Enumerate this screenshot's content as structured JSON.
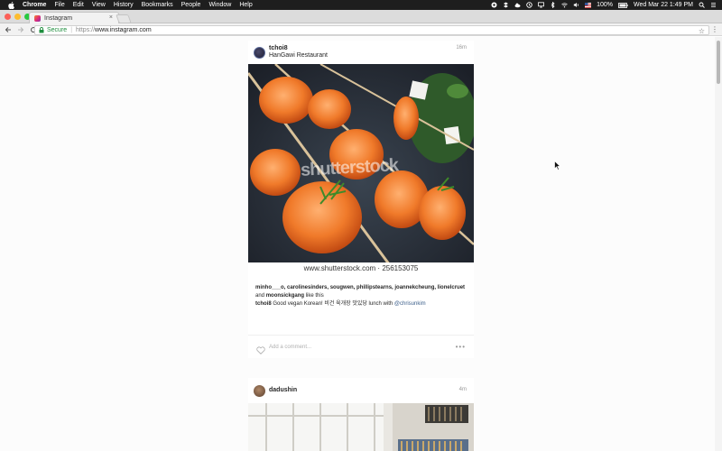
{
  "menubar": {
    "app": "Chrome",
    "items": [
      "File",
      "Edit",
      "View",
      "History",
      "Bookmarks",
      "People",
      "Window",
      "Help"
    ],
    "battery": "100%",
    "clock": "Wed Mar 22  1:49 PM"
  },
  "tab": {
    "title": "Instagram",
    "close": "×"
  },
  "toolbar": {
    "secure_label": "Secure",
    "url_scheme": "https://",
    "url_host": "www.instagram.com"
  },
  "posts": [
    {
      "username": "tchoi8",
      "location": "HanGawi Restaurant",
      "time": "16m",
      "photo": {
        "watermark": "shutterstock",
        "caption": "www.shutterstock.com · 256153075"
      },
      "likes": {
        "line1": "minho___o, carolinesinders, sougwen, phillipstearns, joannekcheung, lionelcruet",
        "and": "and",
        "last": "moonsickgang",
        "suffix": "like this"
      },
      "caption": {
        "user": "tchoi8",
        "text": "Good vegan Korean! 비건 육개장 맛있당 lunch with",
        "mention": "@chrisunkim"
      },
      "comment_placeholder": "Add a comment...",
      "more": "•••"
    },
    {
      "username": "dadushin",
      "time": "4m"
    }
  ],
  "colors": {
    "menubar_bg": "#1e1e1e",
    "link": "#3b5e8a",
    "secure_green": "#1e8e3e",
    "traffic_red": "#fc5f57",
    "traffic_yellow": "#fdbc2e",
    "traffic_green": "#28c840"
  }
}
